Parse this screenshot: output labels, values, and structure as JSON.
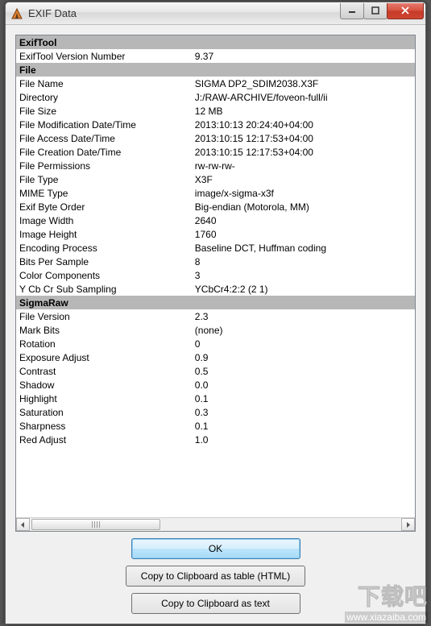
{
  "window": {
    "title": "EXIF Data"
  },
  "buttons": {
    "ok": "OK",
    "copy_html": "Copy to Clipboard as table (HTML)",
    "copy_text": "Copy to Clipboard as text"
  },
  "watermark": {
    "big": "下载吧",
    "url": "www.xiazaiba.com"
  },
  "sections": [
    {
      "name": "ExifTool",
      "rows": [
        {
          "k": "ExifTool Version Number",
          "v": "9.37"
        }
      ]
    },
    {
      "name": "File",
      "rows": [
        {
          "k": "File Name",
          "v": "SIGMA DP2_SDIM2038.X3F"
        },
        {
          "k": "Directory",
          "v": "J:/RAW-ARCHIVE/foveon-full/ii"
        },
        {
          "k": "File Size",
          "v": "12 MB"
        },
        {
          "k": "File Modification Date/Time",
          "v": "2013:10:13 20:24:40+04:00"
        },
        {
          "k": "File Access Date/Time",
          "v": "2013:10:15 12:17:53+04:00"
        },
        {
          "k": "File Creation Date/Time",
          "v": "2013:10:15 12:17:53+04:00"
        },
        {
          "k": "File Permissions",
          "v": "rw-rw-rw-"
        },
        {
          "k": "File Type",
          "v": "X3F"
        },
        {
          "k": "MIME Type",
          "v": "image/x-sigma-x3f"
        },
        {
          "k": "Exif Byte Order",
          "v": "Big-endian (Motorola, MM)"
        },
        {
          "k": "Image Width",
          "v": "2640"
        },
        {
          "k": "Image Height",
          "v": "1760"
        },
        {
          "k": "Encoding Process",
          "v": "Baseline DCT, Huffman coding"
        },
        {
          "k": "Bits Per Sample",
          "v": "8"
        },
        {
          "k": "Color Components",
          "v": "3"
        },
        {
          "k": "Y Cb Cr Sub Sampling",
          "v": "YCbCr4:2:2 (2 1)"
        }
      ]
    },
    {
      "name": "SigmaRaw",
      "rows": [
        {
          "k": "File Version",
          "v": "2.3"
        },
        {
          "k": "Mark Bits",
          "v": "(none)"
        },
        {
          "k": "Rotation",
          "v": "0"
        },
        {
          "k": "Exposure Adjust",
          "v": "0.9"
        },
        {
          "k": "Contrast",
          "v": "0.5"
        },
        {
          "k": "Shadow",
          "v": "0.0"
        },
        {
          "k": "Highlight",
          "v": "0.1"
        },
        {
          "k": "Saturation",
          "v": "0.3"
        },
        {
          "k": "Sharpness",
          "v": "0.1"
        },
        {
          "k": "Red Adjust",
          "v": "1.0"
        }
      ]
    }
  ]
}
